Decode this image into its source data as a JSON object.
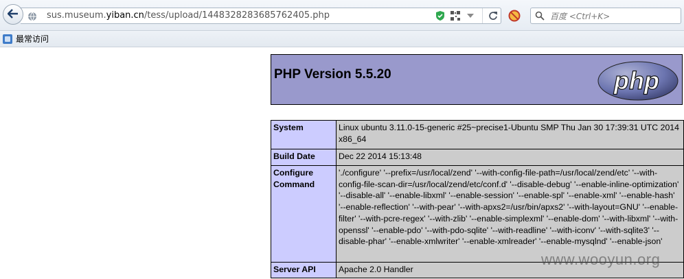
{
  "browser": {
    "url_prefix": "sus.museum.",
    "url_host": "yiban.cn",
    "url_suffix": "/tess/upload/1448328283685762405.php",
    "search_placeholder": "百度 <Ctrl+K>",
    "bookmark_label": "最常访问"
  },
  "page": {
    "title": "PHP Version 5.5.20",
    "logo_text": "php",
    "rows": [
      {
        "key": "System",
        "value": "Linux ubuntu 3.11.0-15-generic #25~precise1-Ubuntu SMP Thu Jan 30 17:39:31 UTC 2014 x86_64"
      },
      {
        "key": "Build Date",
        "value": "Dec 22 2014 15:13:48"
      },
      {
        "key": "Configure Command",
        "value": "'./configure' '--prefix=/usr/local/zend' '--with-config-file-path=/usr/local/zend/etc' '--with-config-file-scan-dir=/usr/local/zend/etc/conf.d' '--disable-debug' '--enable-inline-optimization' '--disable-all' '--enable-libxml' '--enable-session' '--enable-spl' '--enable-xml' '--enable-hash' '--enable-reflection' '--with-pear' '--with-apxs2=/usr/bin/apxs2' '--with-layout=GNU' '--enable-filter' '--with-pcre-regex' '--with-zlib' '--enable-simplexml' '--enable-dom' '--with-libxml' '--with-openssl' '--enable-pdo' '--with-pdo-sqlite' '--with-readline' '--with-iconv' '--with-sqlite3' '--disable-phar' '--enable-xmlwriter' '--enable-xmlreader' '--enable-mysqlnd' '--enable-json'"
      },
      {
        "key": "Server API",
        "value": "Apache 2.0 Handler"
      }
    ]
  },
  "watermark": "www.wooyun.org",
  "colors": {
    "header_bg": "#9999cc",
    "key_bg": "#ccccff",
    "value_bg": "#cccccc",
    "shield_green": "#2fa84f"
  },
  "icons": [
    "back-arrow-icon",
    "globe-icon",
    "shield-icon",
    "qr-code-icon",
    "dropdown-icon",
    "reload-icon",
    "block-icon",
    "search-icon",
    "bookmark-folder-icon"
  ]
}
